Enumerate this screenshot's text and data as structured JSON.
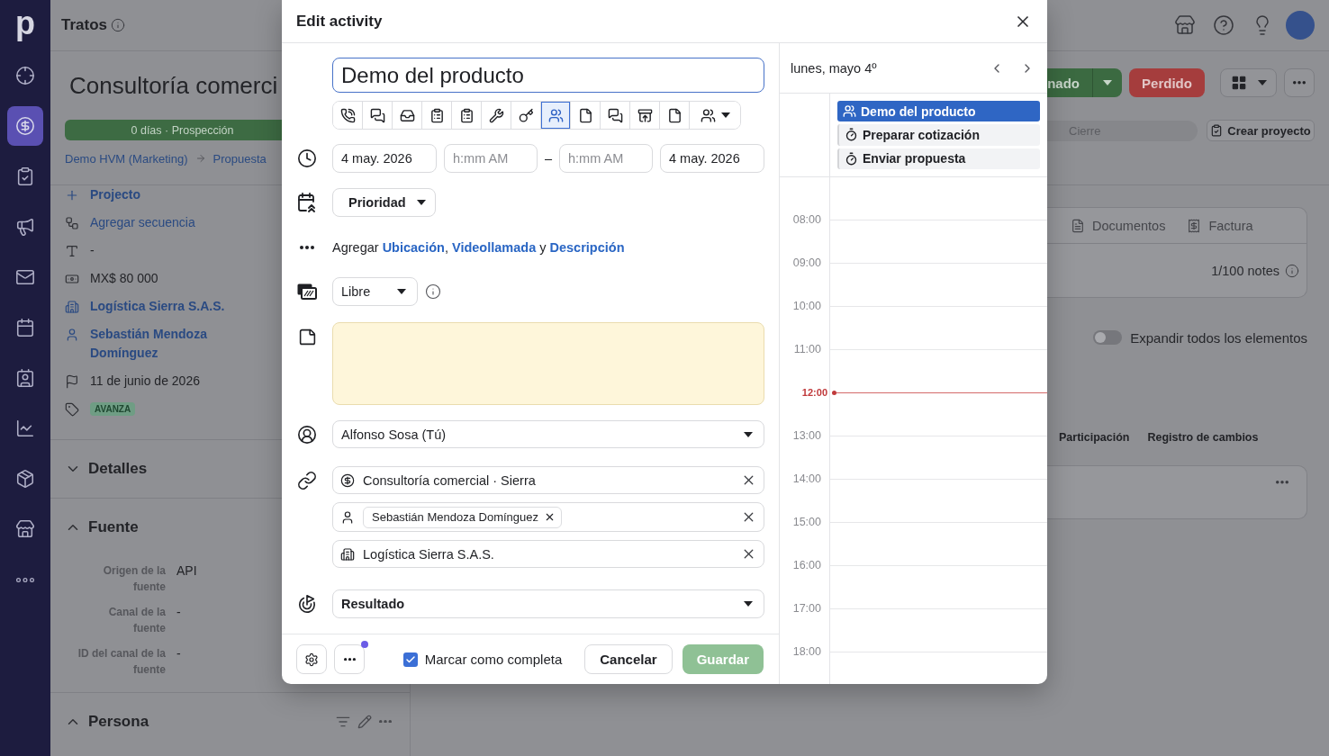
{
  "nav": {
    "logo": "p",
    "items": [
      {
        "selected": false
      },
      {
        "selected": true
      },
      {
        "selected": false
      },
      {
        "selected": false
      },
      {
        "selected": false
      },
      {
        "selected": false
      },
      {
        "selected": false
      },
      {
        "selected": false
      },
      {
        "selected": false
      },
      {
        "selected": false
      },
      {
        "selected": false
      }
    ]
  },
  "topbar": {
    "title": "Tratos"
  },
  "deal": {
    "title": "Consultoría comerci",
    "stage_bar": "0 días · Prospección",
    "pipeline": "Demo HVM (Marketing)",
    "stage": "Propuesta",
    "fields": [
      {
        "kind": "link",
        "text": "Projecto"
      },
      {
        "kind": "action",
        "text": "Agregar secuencia"
      },
      {
        "kind": "text",
        "text": "-"
      },
      {
        "kind": "text",
        "text": "MX$ 80 000"
      },
      {
        "kind": "link",
        "text": "Logística Sierra S.A.S."
      },
      {
        "kind": "link",
        "text": "Sebastián Mendoza Domínguez"
      },
      {
        "kind": "text",
        "text": "11 de junio de 2026"
      },
      {
        "kind": "tag",
        "text": "AVANZA"
      }
    ],
    "sections": [
      {
        "title": "Detalles",
        "expanded": false,
        "tools": false
      },
      {
        "title": "Fuente",
        "expanded": true,
        "tools": false,
        "fields": [
          {
            "label": "Origen de la fuente",
            "value": "API"
          },
          {
            "label": "Canal de la fuente",
            "value": "-"
          },
          {
            "label": "ID del canal de la fuente",
            "value": "-"
          }
        ]
      },
      {
        "title": "Persona",
        "expanded": true,
        "tools": true
      }
    ]
  },
  "actions": {
    "won": "nado",
    "lost": "Perdido",
    "next_stage": "Cierre",
    "create_project": "Crear proyecto"
  },
  "content_tabs": [
    "Documentos",
    "Factura"
  ],
  "notes_count": "1/100 notes",
  "expand_toggle": {
    "label": "Expandir todos los elementos",
    "on": false
  },
  "history_tabs": [
    "Participación",
    "Registro de cambios"
  ],
  "modal": {
    "title": "Edit activity",
    "subject": "Demo del producto",
    "types": [
      {
        "kind": "button",
        "selected": false
      },
      {
        "kind": "button",
        "selected": false
      },
      {
        "kind": "button",
        "selected": false
      },
      {
        "kind": "button",
        "selected": false
      },
      {
        "kind": "button",
        "selected": false
      },
      {
        "kind": "button",
        "selected": false
      },
      {
        "kind": "button",
        "selected": false
      },
      {
        "kind": "button",
        "selected": true
      },
      {
        "kind": "button",
        "selected": false
      },
      {
        "kind": "button",
        "selected": false
      },
      {
        "kind": "button",
        "selected": false
      },
      {
        "kind": "button",
        "selected": false
      },
      {
        "kind": "menu",
        "selected": false
      }
    ],
    "start_date": "4 may. 2026",
    "start_time": {
      "placeholder": "h:mm AM"
    },
    "range_separator": "–",
    "end_time": {
      "placeholder": "h:mm AM"
    },
    "end_date": "4 may. 2026",
    "priority": "Prioridad",
    "add_details": [
      {
        "kind": "text",
        "text": "Agregar"
      },
      {
        "kind": "link",
        "text": "Ubicación"
      },
      {
        "kind": "punct",
        "text": ","
      },
      {
        "kind": "link",
        "text": "Videollamada"
      },
      {
        "kind": "text",
        "text": "y"
      },
      {
        "kind": "link",
        "text": "Descripción"
      }
    ],
    "availability": "Libre",
    "owner": "Alfonso Sosa (Tú)",
    "links": [
      {
        "kind": "deal",
        "text": "Consultoría comercial · Sierra"
      },
      {
        "kind": "person",
        "chips": [
          "Sebastián Mendoza Domínguez"
        ]
      },
      {
        "kind": "organization",
        "text": "Logística Sierra S.A.S."
      }
    ],
    "outcome": "Resultado",
    "more_badge": true,
    "mark_done": {
      "label": "Marcar como completa",
      "checked": true
    },
    "buttons": [
      {
        "kind": "secondary",
        "label": "Cancelar",
        "disabled": false
      },
      {
        "kind": "primary",
        "label": "Guardar",
        "disabled": true
      }
    ]
  },
  "calendar": {
    "date": "lunes, mayo 4º",
    "events": [
      {
        "kind": "meeting",
        "title": "Demo del producto",
        "selected": true
      },
      {
        "kind": "task",
        "title": "Preparar cotización",
        "selected": false
      },
      {
        "kind": "task",
        "title": "Enviar propuesta",
        "selected": false
      }
    ],
    "hours": [
      {
        "label": "08:00",
        "current": false
      },
      {
        "label": "09:00",
        "current": false
      },
      {
        "label": "10:00",
        "current": false
      },
      {
        "label": "11:00",
        "current": false
      },
      {
        "label": "12:00",
        "current": true
      },
      {
        "label": "13:00",
        "current": false
      },
      {
        "label": "14:00",
        "current": false
      },
      {
        "label": "15:00",
        "current": false
      },
      {
        "label": "16:00",
        "current": false
      },
      {
        "label": "17:00",
        "current": false
      },
      {
        "label": "18:00",
        "current": false
      }
    ]
  }
}
